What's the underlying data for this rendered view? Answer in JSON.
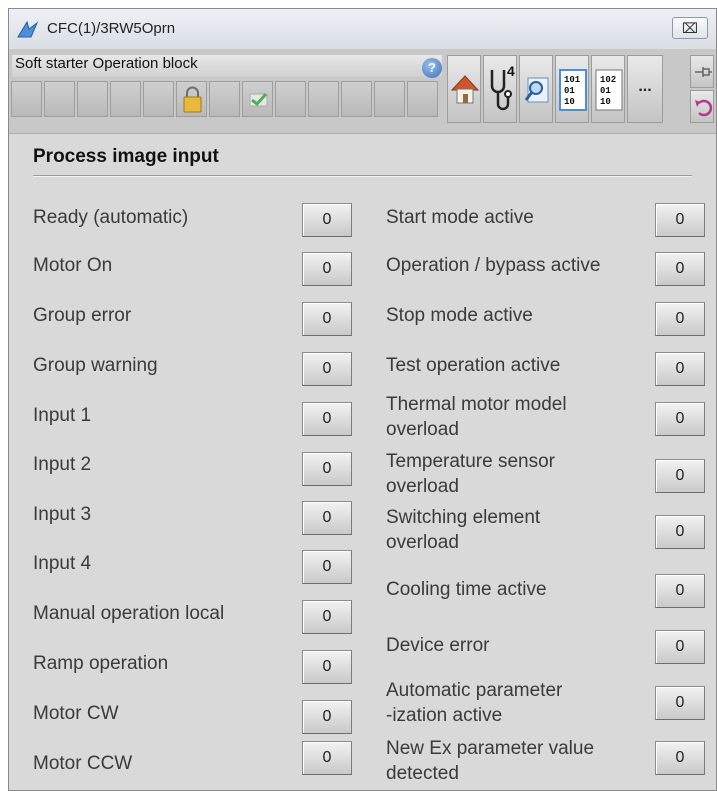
{
  "window": {
    "title": "CFC(1)/3RW5Oprn",
    "close_label": "⌧"
  },
  "toolbar": {
    "block_title": "Soft starter Operation block",
    "help_label": "?",
    "status_cells": 12,
    "icons": [
      "help-icon",
      "home-icon",
      "stethoscope-icon",
      "magnifier-icon",
      "binary-1-icon",
      "binary-2-icon",
      "more-icon",
      "pin-icon",
      "undo-icon",
      "lock-icon",
      "check-icon"
    ],
    "stethoscope_number": "4",
    "binary1": {
      "lines": [
        "101",
        "01",
        "10"
      ]
    },
    "binary2": {
      "lines": [
        "102",
        "01",
        "10"
      ]
    },
    "more_label": "..."
  },
  "section": {
    "title": "Process image input"
  },
  "left_items": [
    {
      "label": "Ready (automatic)",
      "value": "0"
    },
    {
      "label": "Motor On",
      "value": "0"
    },
    {
      "label": "Group error",
      "value": "0"
    },
    {
      "label": "Group warning",
      "value": "0"
    },
    {
      "label": "Input 1",
      "value": "0"
    },
    {
      "label": "Input 2",
      "value": "0"
    },
    {
      "label": "Input 3",
      "value": "0"
    },
    {
      "label": "Input 4",
      "value": "0"
    },
    {
      "label": "Manual operation local",
      "value": "0"
    },
    {
      "label": "Ramp operation",
      "value": "0"
    },
    {
      "label": "Motor CW",
      "value": "0"
    },
    {
      "label": "Motor CCW",
      "value": "0"
    }
  ],
  "right_items": [
    {
      "label": [
        "Start mode active"
      ],
      "value": "0"
    },
    {
      "label": [
        "Operation / bypass active"
      ],
      "value": "0"
    },
    {
      "label": [
        "Stop mode active"
      ],
      "value": "0"
    },
    {
      "label": [
        "Test operation active"
      ],
      "value": "0"
    },
    {
      "label": [
        "Thermal motor model",
        "overload"
      ],
      "value": "0"
    },
    {
      "label": [
        "Temperature sensor",
        "overload"
      ],
      "value": "0"
    },
    {
      "label": [
        "Switching element",
        "overload"
      ],
      "value": "0"
    },
    {
      "label": [
        "Cooling time active"
      ],
      "value": "0"
    },
    {
      "label": [
        "Device error"
      ],
      "value": "0"
    },
    {
      "label": [
        "Automatic parameter",
        "-ization active"
      ],
      "value": "0"
    },
    {
      "label": [
        "New Ex parameter value",
        "detected"
      ],
      "value": "0"
    }
  ],
  "colors": {
    "panel": "#d9d9d9",
    "toolbar": "#c8c8c8",
    "lock": "#e8b93a",
    "check": "#4caf50",
    "home_roof": "#d0552a"
  }
}
